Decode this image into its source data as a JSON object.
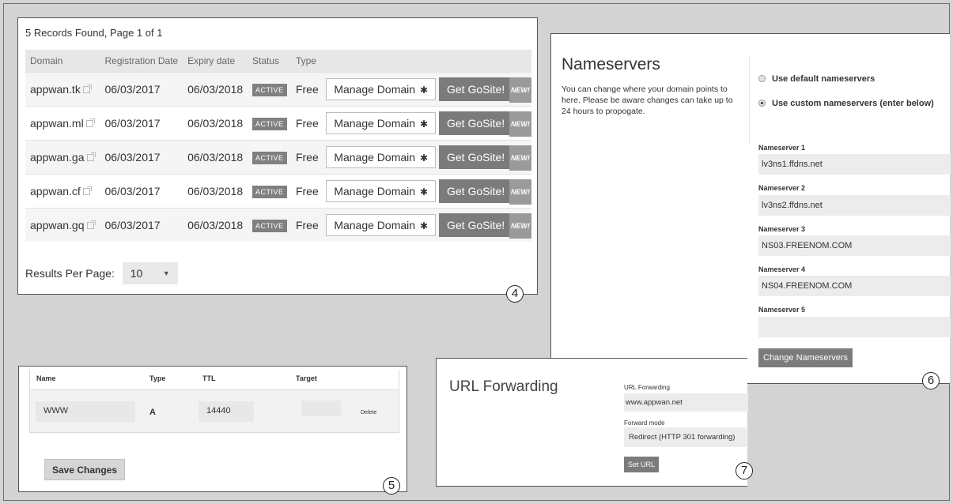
{
  "domains_panel": {
    "records_text": "5 Records Found, Page 1 of 1",
    "columns": [
      "Domain",
      "Registration Date",
      "Expiry date",
      "Status",
      "Type"
    ],
    "rows": [
      {
        "domain": "appwan.tk",
        "registration": "06/03/2017",
        "expiry": "06/03/2018",
        "status": "ACTIVE",
        "type": "Free",
        "manage": "Manage Domain",
        "gosite": "Get GoSite!",
        "new": "NEW!"
      },
      {
        "domain": "appwan.ml",
        "registration": "06/03/2017",
        "expiry": "06/03/2018",
        "status": "ACTIVE",
        "type": "Free",
        "manage": "Manage Domain",
        "gosite": "Get GoSite!",
        "new": "NEW!"
      },
      {
        "domain": "appwan.ga",
        "registration": "06/03/2017",
        "expiry": "06/03/2018",
        "status": "ACTIVE",
        "type": "Free",
        "manage": "Manage Domain",
        "gosite": "Get GoSite!",
        "new": "NEW!"
      },
      {
        "domain": "appwan.cf",
        "registration": "06/03/2017",
        "expiry": "06/03/2018",
        "status": "ACTIVE",
        "type": "Free",
        "manage": "Manage Domain",
        "gosite": "Get GoSite!",
        "new": "NEW!"
      },
      {
        "domain": "appwan.gq",
        "registration": "06/03/2017",
        "expiry": "06/03/2018",
        "status": "ACTIVE",
        "type": "Free",
        "manage": "Manage Domain",
        "gosite": "Get GoSite!",
        "new": "NEW!"
      }
    ],
    "results_per_page_label": "Results Per Page:",
    "results_per_page_value": "10",
    "callout": "4"
  },
  "nameservers_panel": {
    "title": "Nameservers",
    "description": "You can change where your domain points to here. Please be aware changes can take up to 24 hours to propogate.",
    "option_default": "Use default nameservers",
    "option_custom": "Use custom nameservers (enter below)",
    "selected_option": "custom",
    "fields": [
      {
        "label": "Nameserver 1",
        "value": "lv3ns1.ffdns.net"
      },
      {
        "label": "Nameserver 2",
        "value": "lv3ns2.ffdns.net"
      },
      {
        "label": "Nameserver 3",
        "value": "NS03.FREENOM.COM"
      },
      {
        "label": "Nameserver 4",
        "value": "NS04.FREENOM.COM"
      },
      {
        "label": "Nameserver 5",
        "value": ""
      }
    ],
    "button": "Change Nameservers",
    "callout": "6"
  },
  "dns_panel": {
    "columns": {
      "name": "Name",
      "type": "Type",
      "ttl": "TTL",
      "target": "Target"
    },
    "record": {
      "name": "WWW",
      "type": "A",
      "ttl": "14440",
      "target": "",
      "delete": "Delete"
    },
    "save_button": "Save Changes",
    "callout": "5"
  },
  "forwarding_panel": {
    "title": "URL Forwarding",
    "url_label": "URL Forwarding",
    "url_value": "www.appwan.net",
    "mode_label": "Forward mode",
    "mode_value": "Redirect (HTTP 301 forwarding)",
    "button": "Set URL",
    "callout": "7"
  },
  "icons": {
    "external_link": "external-link-icon",
    "gear": "gear-icon",
    "caret": "caret-down-icon"
  },
  "colors": {
    "background": "#d4d4d4",
    "panel": "#ffffff",
    "button_gray": "#7b7b7b",
    "input_gray": "#ececec"
  }
}
